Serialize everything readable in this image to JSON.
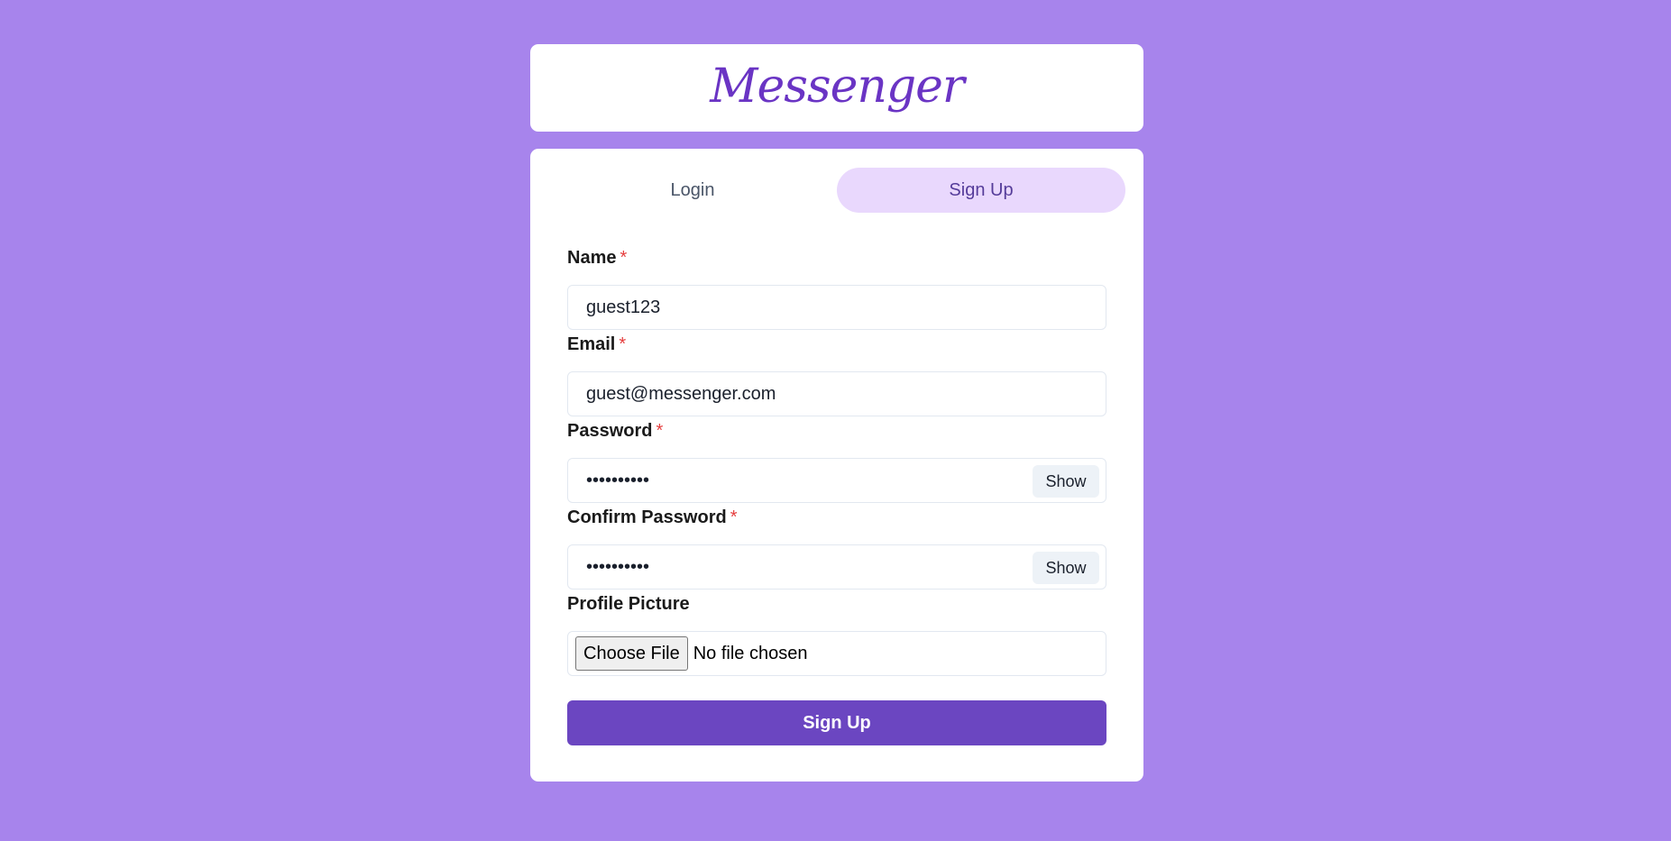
{
  "app": {
    "logo_text": "Messenger"
  },
  "tabs": [
    {
      "label": "Login",
      "active": false
    },
    {
      "label": "Sign Up",
      "active": true
    }
  ],
  "form": {
    "name": {
      "label": "Name",
      "required_mark": "*",
      "value": "guest123"
    },
    "email": {
      "label": "Email",
      "required_mark": "*",
      "value": "guest@messenger.com"
    },
    "password": {
      "label": "Password",
      "required_mark": "*",
      "value": "••••••••••",
      "toggle_label": "Show"
    },
    "confirm_password": {
      "label": "Confirm Password",
      "required_mark": "*",
      "value": "••••••••••",
      "toggle_label": "Show"
    },
    "profile_picture": {
      "label": "Profile Picture",
      "button_label": "Choose File",
      "status": "No file chosen"
    },
    "submit_label": "Sign Up"
  },
  "colors": {
    "background": "#a784ec",
    "accent": "#6b46c1",
    "active_tab": "#e9d8fd",
    "required": "#e53e3e"
  }
}
